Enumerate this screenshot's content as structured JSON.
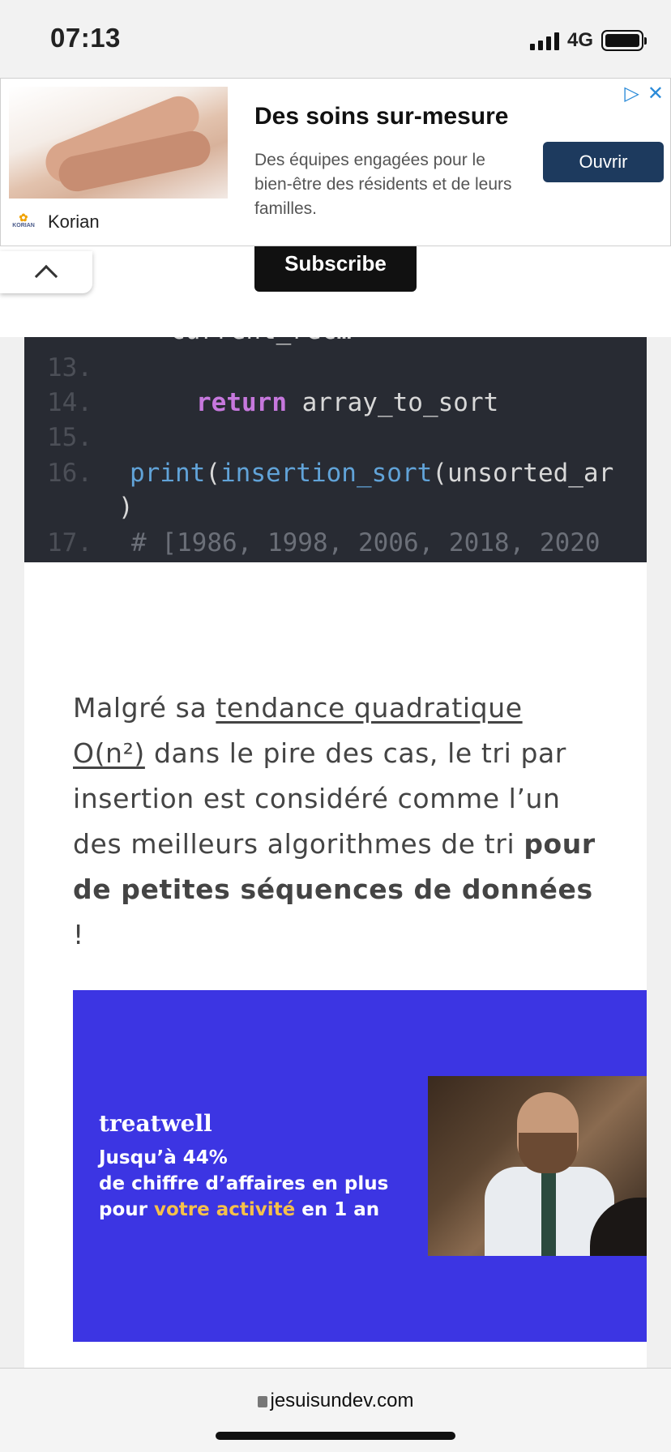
{
  "status_bar": {
    "time": "07:13",
    "network": "4G"
  },
  "top_ad": {
    "title": "Des soins sur-mesure",
    "description": "Des équipes engagées pour le bien-être des résidents et de leurs familles.",
    "brand": "Korian",
    "logo_text": "KORIAN",
    "cta": "Ouvrir",
    "choices_icon": "ad-choices-icon",
    "close_icon": "close-icon"
  },
  "subscribe": {
    "label": "Subscribe"
  },
  "code": {
    "cut_line": "current_rec…",
    "lines": [
      {
        "num": "13.",
        "text": ""
      },
      {
        "num": "14.",
        "keyword": "return",
        "rest": " array_to_sort"
      },
      {
        "num": "15.",
        "text": ""
      },
      {
        "num": "16.",
        "fn1": "print",
        "p1": "(",
        "fn2": "insertion_sort",
        "rest": "(unsorted_ar",
        "wrap": ")"
      },
      {
        "num": "17.",
        "comment": "# [1986, 1998, 2006, 2018, 2020"
      }
    ]
  },
  "paragraph": {
    "part1": "Malgré sa ",
    "link": "tendance quadratique O(n²)",
    "part2": " dans le pire des cas, le tri par insertion est considéré comme l’un des meilleurs algorithmes de tri ",
    "strong": "pour de petites séquences de données",
    "part3": " !"
  },
  "treatwell_ad": {
    "logo": "treatwell",
    "line1": "Jusqu’à 44%",
    "line2": "de chiffre d’affaires en plus",
    "line3_a": "pour ",
    "line3_hl": "votre activité",
    "line3_b": " en 1 an"
  },
  "address_bar": {
    "url": "jesuisundev.com"
  }
}
